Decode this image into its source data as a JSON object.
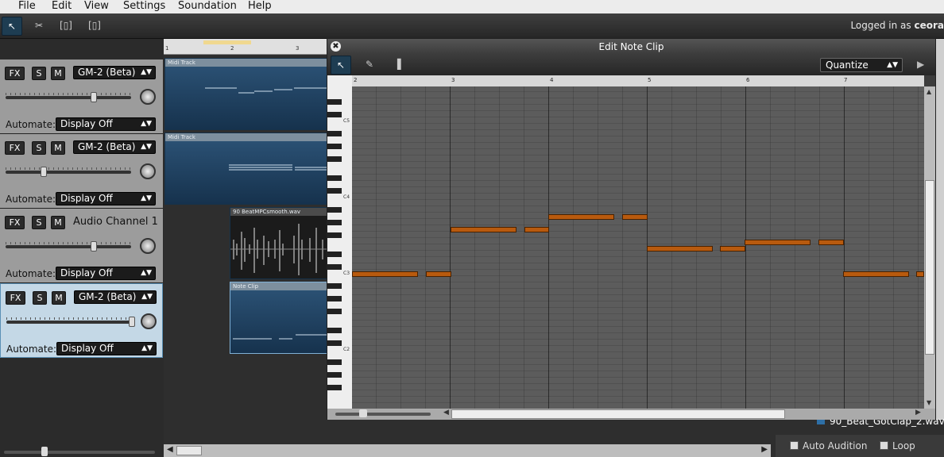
{
  "menu": [
    "File",
    "Edit",
    "View",
    "Settings",
    "Soundation",
    "Help"
  ],
  "login": {
    "prefix": "Logged in as ",
    "user": "ceora"
  },
  "tracks": [
    {
      "fx": "FX",
      "s": "S",
      "m": "M",
      "instrument": "GM-2 (Beta)",
      "automate_label": "Automate:",
      "automate_value": "Display Off",
      "volume": 0.72,
      "selected": false
    },
    {
      "fx": "FX",
      "s": "S",
      "m": "M",
      "instrument": "GM-2 (Beta)",
      "automate_label": "Automate:",
      "automate_value": "Display Off",
      "volume": 0.31,
      "selected": false
    },
    {
      "fx": "FX",
      "s": "S",
      "m": "M",
      "instrument": "Audio Channel 1",
      "automate_label": "Automate:",
      "automate_value": "Display Off",
      "volume": 0.72,
      "selected": false,
      "audio": true
    },
    {
      "fx": "FX",
      "s": "S",
      "m": "M",
      "instrument": "GM-2 (Beta)",
      "automate_label": "Automate:",
      "automate_value": "Display Off",
      "volume": 1.0,
      "selected": true
    }
  ],
  "clips": {
    "midi1": "Midi Track",
    "midi2": "Midi Track",
    "audio": "90 BeatMPCsmooth.wav",
    "note": "Note Clip"
  },
  "main_ruler": [
    "1",
    "2",
    "3"
  ],
  "editor": {
    "title": "Edit Note Clip",
    "quantize": "Quantize",
    "ruler": [
      "2",
      "3",
      "4",
      "5",
      "6",
      "7"
    ],
    "key_labels": [
      "C5",
      "C4",
      "C3",
      "C2"
    ]
  },
  "right": {
    "file": "90_Beat_GotClap_2.wav",
    "auto_audition": "Auto Audition",
    "loop": "Loop"
  },
  "colors": {
    "note": "#b85a0e",
    "clip": "#1e3d5c",
    "accent": "#1e3d52"
  }
}
